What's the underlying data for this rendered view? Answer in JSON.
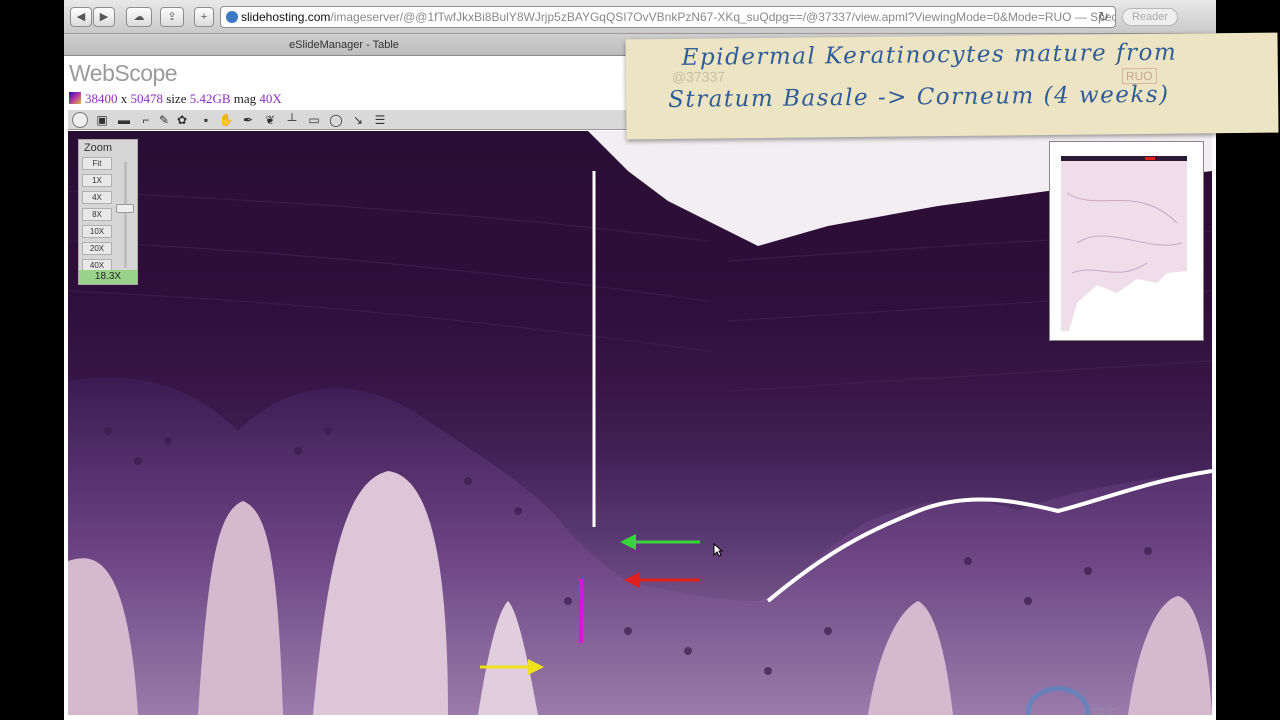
{
  "browser": {
    "url_host": "slidehosting.com",
    "url_path": "/imageserver/@@1fTwfJkxBi8BulY8WJrjp5zBAYGqQSI7OvVBnkPzN67-XKq_suQdpg==/@37337/view.apml?ViewingMode=0&Mode=RUO — Spec...",
    "reader_label": "Reader",
    "back_icon": "back-arrow-icon",
    "forward_icon": "forward-arrow-icon",
    "cloud_icon": "icloud-icon",
    "share_icon": "share-icon",
    "add_icon": "plus-icon",
    "reload_icon": "reload-icon"
  },
  "tab": {
    "title": "eSlideManager - Table"
  },
  "app": {
    "logo": "WebScope",
    "width_value": "38400",
    "x_sep": "x",
    "height_value": "50478",
    "size_label": "size",
    "size_value": "5.42GB",
    "mag_label": "mag",
    "mag_value": "40X"
  },
  "toolbar_icons": [
    "nav-icon",
    "thumbnail-icon",
    "ruler-icon",
    "annotation-icon",
    "edit-icon",
    "filter-icon",
    "save-icon",
    "hand-pan-icon",
    "pen-icon",
    "magic-wand-icon",
    "measure-icon",
    "rectangle-icon",
    "ellipse-icon",
    "arrow-icon",
    "list-icon"
  ],
  "zoom": {
    "title": "Zoom",
    "levels": [
      "Fit",
      "1X",
      "4X",
      "8X",
      "10X",
      "20X",
      "40X"
    ],
    "current": "18.3X",
    "current_fraction": 0.44
  },
  "note": {
    "line1": "Epidermal Keratinocytes mature from",
    "line2": "Stratum Basale -> Corneum (4 weeks)",
    "ghost_id": "@37337",
    "ghost_tag": "RUO"
  },
  "annotations": [
    {
      "name": "white-vertical-line",
      "color": "#ffffff"
    },
    {
      "name": "green-arrow",
      "color": "#39d33a"
    },
    {
      "name": "red-arrow",
      "color": "#e0201c"
    },
    {
      "name": "magenta-bar",
      "color": "#d21ad6"
    },
    {
      "name": "yellow-arrow",
      "color": "#f0e21a"
    }
  ],
  "watermark": {
    "text": "ar"
  },
  "colors": {
    "stain_dark": "#2a0d33",
    "stain_mid": "#5a2c72",
    "tissue_pink": "#d7b9cf",
    "note_ink": "#2f5d97"
  }
}
